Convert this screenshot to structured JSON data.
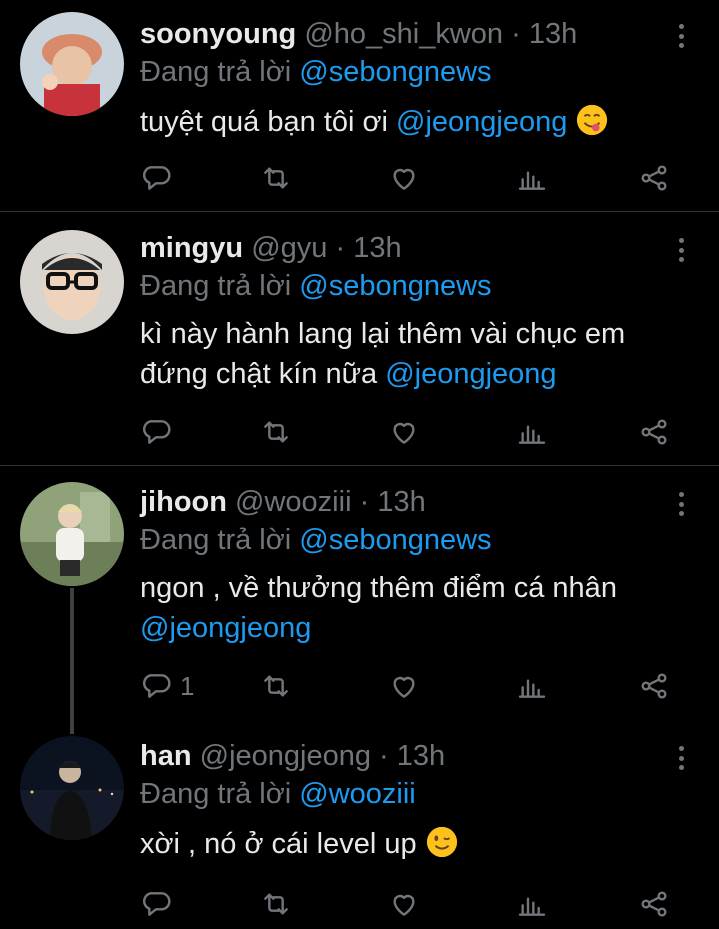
{
  "replying_prefix": "Đang trả lời",
  "tweets": [
    {
      "name": "soonyoung",
      "handle": "@ho_shi_kwon",
      "dot": "·",
      "time": "13h",
      "reply_to": "@sebongnews",
      "text_lines": [
        "tuyệt quá bạn tôi ơi"
      ],
      "mention": "@jeongjeong",
      "emoji": "face-savoring-food-emoji",
      "reply_count": ""
    },
    {
      "name": "mingyu",
      "handle": "@gyu",
      "dot": "·",
      "time": "13h",
      "reply_to": "@sebongnews",
      "text_lines": [
        "kì này hành lang lại thêm vài chục em",
        "đứng chật kín nữa"
      ],
      "mention": "@jeongjeong",
      "reply_count": ""
    },
    {
      "name": "jihoon",
      "handle": "@wooziii",
      "dot": "·",
      "time": "13h",
      "reply_to": "@sebongnews",
      "text_lines": [
        "ngon , về thưởng thêm điểm cá nhân"
      ],
      "mention": "@jeongjeong",
      "reply_count": "1"
    },
    {
      "name": "han",
      "handle": "@jeongjeong",
      "dot": "·",
      "time": "13h",
      "reply_to": "@wooziii",
      "text_lines": [
        "xời , nó ở cái level up"
      ],
      "emoji": "winking-face-emoji",
      "reply_count": ""
    }
  ],
  "colors": {
    "background": "#000000",
    "text": "#e7e9ea",
    "muted": "#71767b",
    "accent": "#1d9bf0",
    "divider": "#2f3336"
  }
}
